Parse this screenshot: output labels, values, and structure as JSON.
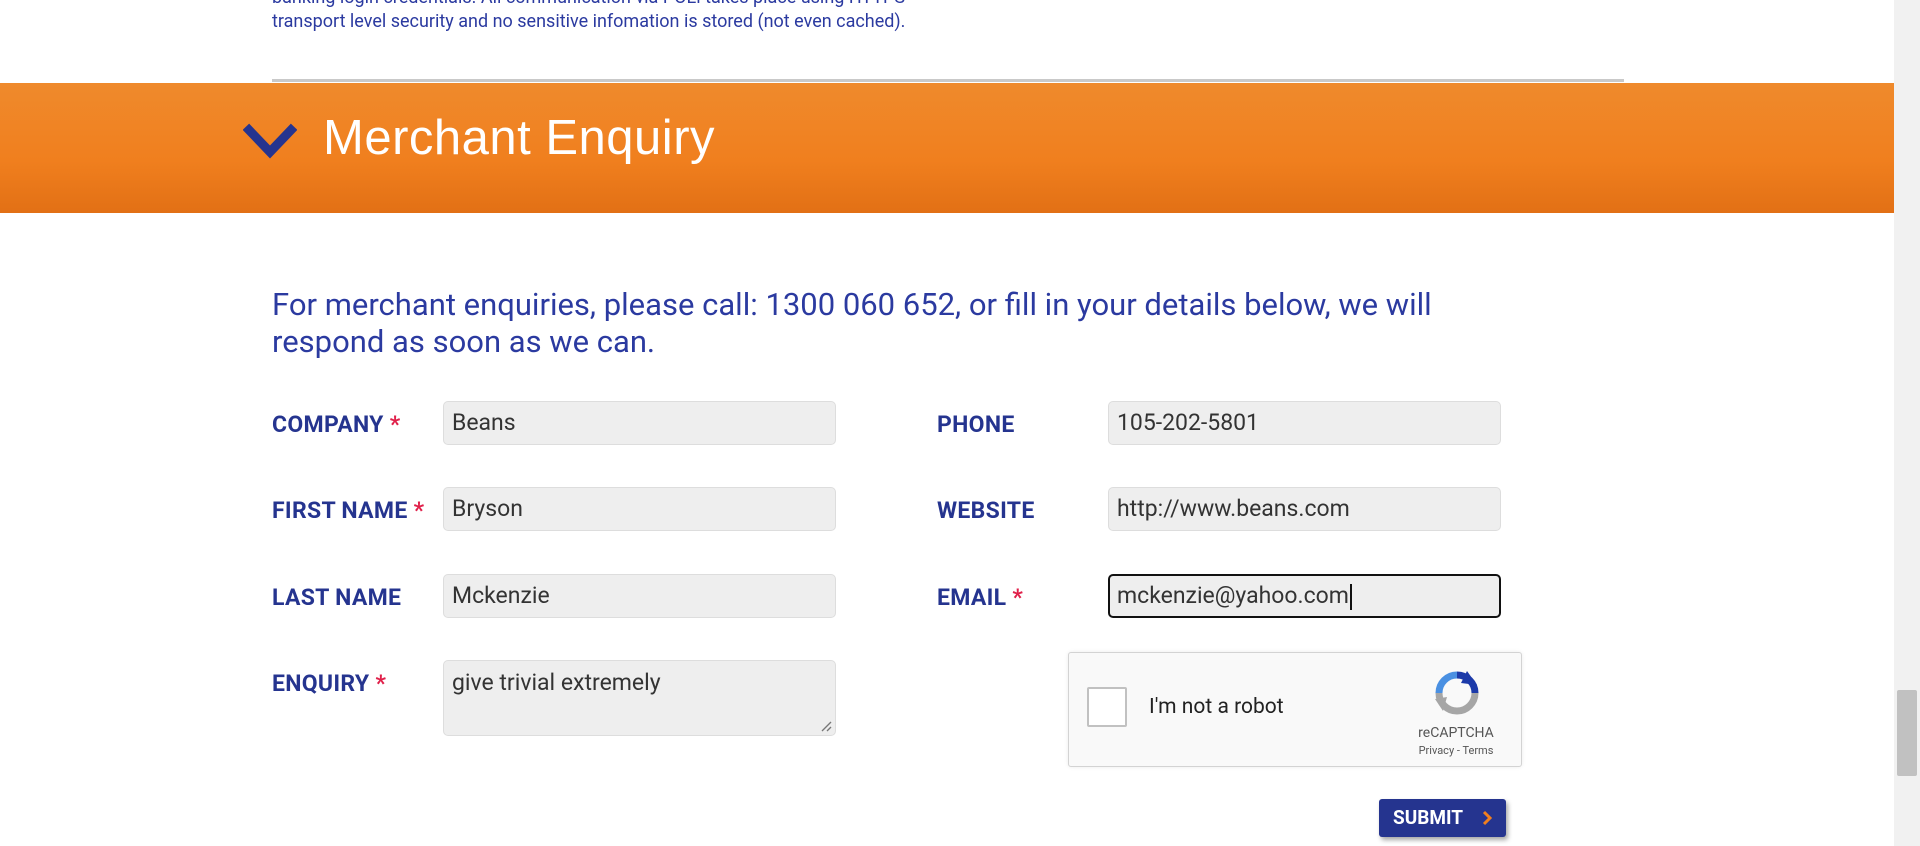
{
  "top_text": "banking login credentials. All communication via POLi takes place using HTTPS transport level security and no sensitive infomation is stored (not even cached).",
  "section": {
    "title": "Merchant Enquiry"
  },
  "intro": "For merchant enquiries, please call: 1300 060 652, or fill in your details below, we will respond as soon as we can.",
  "form": {
    "company": {
      "label": "COMPANY",
      "value": "Beans",
      "required": "*"
    },
    "first_name": {
      "label": "FIRST NAME",
      "value": "Bryson",
      "required": "*"
    },
    "last_name": {
      "label": "LAST NAME",
      "value": "Mckenzie"
    },
    "enquiry": {
      "label": "ENQUIRY",
      "value": "give trivial extremely",
      "required": "*"
    },
    "phone": {
      "label": "PHONE",
      "value": "105-202-5801"
    },
    "website": {
      "label": "WEBSITE",
      "value": "http://www.beans.com"
    },
    "email": {
      "label": "EMAIL",
      "value": "mckenzie@yahoo.com",
      "required": "*"
    }
  },
  "captcha": {
    "label": "I'm not a robot",
    "brand": "reCAPTCHA",
    "privacy": "Privacy",
    "separator": " - ",
    "terms": "Terms"
  },
  "submit_label": "SUBMIT",
  "colors": {
    "banner": "#f07f1e",
    "brand_blue": "#25348f",
    "required": "#e0204a"
  },
  "icons": {
    "chevron": "chevron-down-icon",
    "submit_arrow": "chevron-right-icon",
    "captcha_logo": "recaptcha-icon"
  }
}
